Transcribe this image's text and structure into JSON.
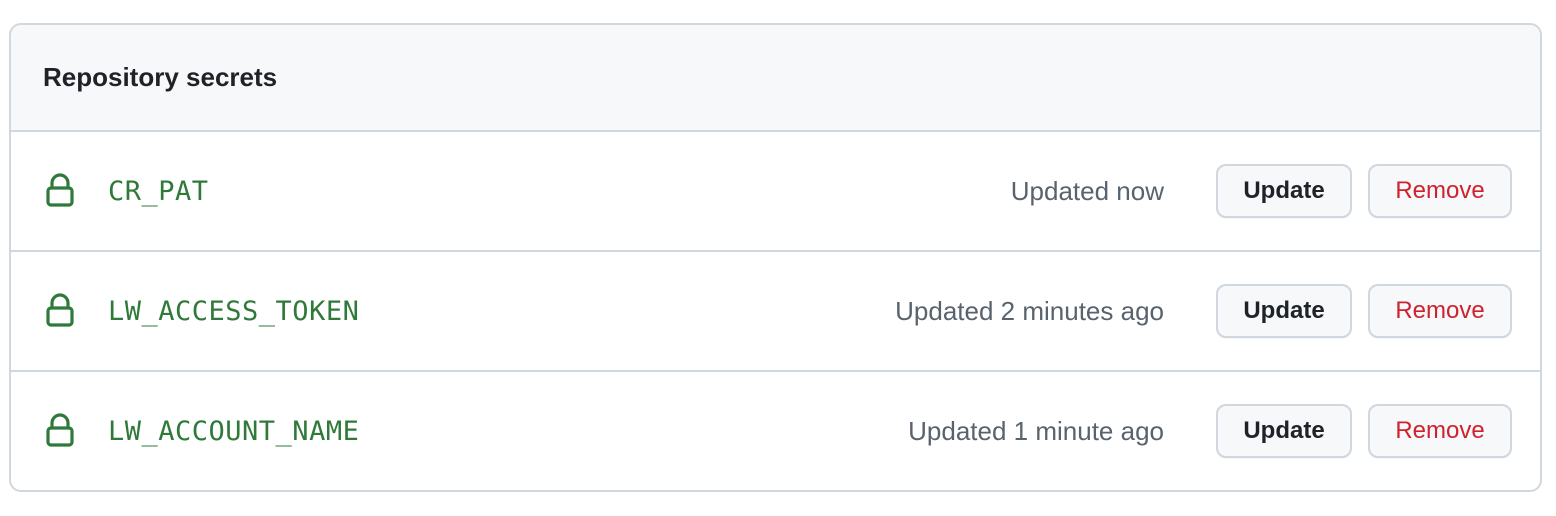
{
  "panel": {
    "title": "Repository secrets"
  },
  "secrets": [
    {
      "name": "CR_PAT",
      "updated": "Updated now",
      "update_label": "Update",
      "remove_label": "Remove"
    },
    {
      "name": "LW_ACCESS_TOKEN",
      "updated": "Updated 2 minutes ago",
      "update_label": "Update",
      "remove_label": "Remove"
    },
    {
      "name": "LW_ACCOUNT_NAME",
      "updated": "Updated 1 minute ago",
      "update_label": "Update",
      "remove_label": "Remove"
    }
  ],
  "icons": {
    "secret_icon": "lock-icon"
  },
  "colors": {
    "secret_name": "#2f7a3a",
    "remove_text": "#cf222e",
    "header_bg": "#f6f8fa",
    "border": "#d0d7de"
  }
}
